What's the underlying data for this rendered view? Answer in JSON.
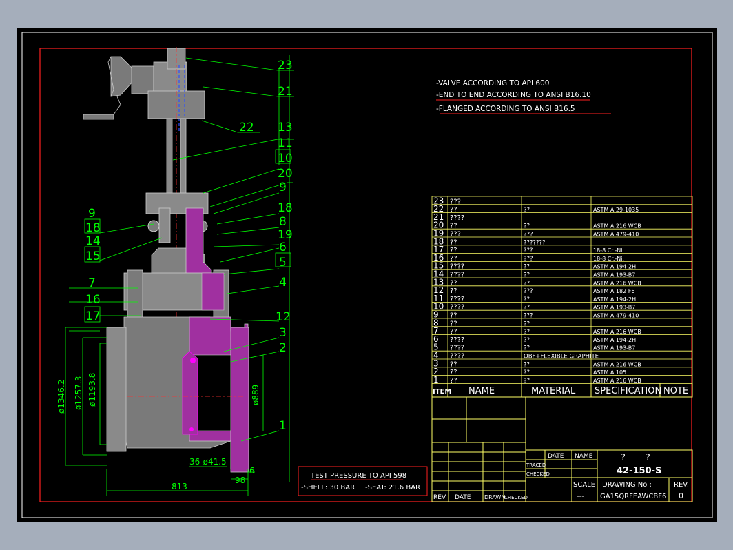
{
  "notes": [
    "-VALVE ACCORDING TO API 600",
    "-END TO END ACCORDING TO ANSI B16.10",
    "-FLANGED ACCORDING TO ANSI B16.5"
  ],
  "parts": [
    {
      "item": "23",
      "name": "???",
      "material": "",
      "spec": ""
    },
    {
      "item": "22",
      "name": "??",
      "material": "??",
      "spec": "ASTM A 29-1035"
    },
    {
      "item": "21",
      "name": "????",
      "material": "",
      "spec": ""
    },
    {
      "item": "20",
      "name": "??",
      "material": "??",
      "spec": "ASTM A 216 WCB"
    },
    {
      "item": "19",
      "name": "???",
      "material": "???",
      "spec": "ASTM A 479-410"
    },
    {
      "item": "18",
      "name": "??",
      "material": "???????",
      "spec": ""
    },
    {
      "item": "17",
      "name": "??",
      "material": "???",
      "spec": "18-8 Cr.-Ni"
    },
    {
      "item": "16",
      "name": "??",
      "material": "???",
      "spec": "18-8 Cr.-Ni."
    },
    {
      "item": "15",
      "name": "????",
      "material": "??",
      "spec": "ASTM A 194-2H"
    },
    {
      "item": "14",
      "name": "????",
      "material": "??",
      "spec": "ASTM A 193-B7"
    },
    {
      "item": "13",
      "name": "??",
      "material": "??",
      "spec": "ASTM A 216 WCB"
    },
    {
      "item": "12",
      "name": "??",
      "material": "???",
      "spec": "ASTM A 182 F6"
    },
    {
      "item": "11",
      "name": "????",
      "material": "??",
      "spec": "ASTM A 194-2H"
    },
    {
      "item": "10",
      "name": "????",
      "material": "??",
      "spec": "ASTM A 193-B7"
    },
    {
      "item": "9",
      "name": "??",
      "material": "???",
      "spec": "ASTM A 479-410"
    },
    {
      "item": "8",
      "name": "??",
      "material": "??",
      "spec": ""
    },
    {
      "item": "7",
      "name": "??",
      "material": "??",
      "spec": "ASTM A 216 WCB"
    },
    {
      "item": "6",
      "name": "????",
      "material": "??",
      "spec": "ASTM A 194-2H"
    },
    {
      "item": "5",
      "name": "????",
      "material": "??",
      "spec": "ASTM A 193-B7"
    },
    {
      "item": "4",
      "name": "????",
      "material": "OBF+FLEXIBLE GRAPHITE",
      "spec": ""
    },
    {
      "item": "3",
      "name": "??",
      "material": "??",
      "spec": "ASTM A 216 WCB"
    },
    {
      "item": "2",
      "name": "??",
      "material": "??",
      "spec": "ASTM A 105"
    },
    {
      "item": "1",
      "name": "??",
      "material": "??",
      "spec": "ASTM A 216 WCB"
    }
  ],
  "headers": {
    "item": "ITEM",
    "name": "NAME",
    "material": "MATERIAL",
    "spec": "SPECIFICATION",
    "note": "NOTE"
  },
  "rev_block": {
    "rev": "REV",
    "date": "DATE",
    "drawn": "DRAWN",
    "checked": "CHECKED"
  },
  "title_block": {
    "date": "DATE",
    "name": "NAME",
    "traced": "TRACED",
    "checked": "CHECKED",
    "title": "?       ?",
    "number": "42-150-S",
    "scale_label": "SCALE",
    "scale_value": "---",
    "drawing_no_label": "DRAWING No :",
    "drawing_no": "GA15QRFEAWCBF6",
    "rev_label": "REV.",
    "rev_value": "0"
  },
  "test_pressure": {
    "title": "TEST PRESSURE TO API 598",
    "shell": "-SHELL: 30 BAR",
    "seat": "-SEAT: 21.6 BAR"
  },
  "dimensions": {
    "d1": "ø1346.2",
    "d2": "ø1257.3",
    "d3": "ø1193.8",
    "d4": "ø889",
    "holes": "36-ø41.5",
    "flange": "98",
    "raised_face": "6",
    "length": "813"
  },
  "callouts_right": [
    "23",
    "21",
    "22",
    "13",
    "11",
    "10",
    "20",
    "9",
    "18",
    "8",
    "19",
    "6",
    "5",
    "4",
    "12",
    "3",
    "2",
    "1"
  ],
  "callouts_left": [
    "9",
    "18",
    "14",
    "15",
    "7",
    "16",
    "17"
  ],
  "colors": {
    "frame": "#ff2020",
    "table": "#ffff66",
    "callout": "#00ff00",
    "body": "#7a7a7a",
    "section": "#a030a0",
    "text": "#ffffff"
  }
}
